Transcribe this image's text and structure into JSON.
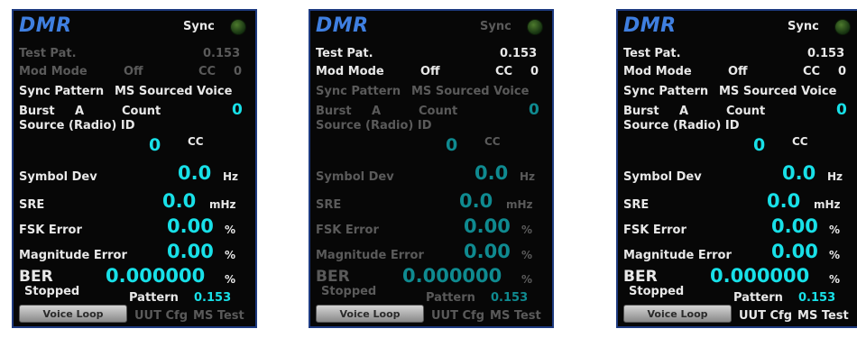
{
  "title": "DMR",
  "sync_label": "Sync",
  "test_pat_label": "Test Pat.",
  "test_pat_value": "0.153",
  "mod_mode_label": "Mod Mode",
  "mod_mode_value": "Off",
  "cc_label": "CC",
  "cc_value": "0",
  "sync_pattern_label": "Sync Pattern",
  "sync_pattern_value": "MS Sourced Voice",
  "burst_label": "Burst",
  "burst_value": "A",
  "count_label": "Count",
  "count_value": "0",
  "source_id_label": "Source (Radio) ID",
  "source_id_value": "0",
  "source_cc_label": "CC",
  "symbol_dev_label": "Symbol Dev",
  "symbol_dev_value": "0.0",
  "symbol_dev_unit": "Hz",
  "sre_label": "SRE",
  "sre_value": "0.0",
  "sre_unit": "mHz",
  "fsk_label": "FSK Error",
  "fsk_value": "0.00",
  "fsk_unit": "%",
  "mag_label": "Magnitude Error",
  "mag_value": "0.00",
  "mag_unit": "%",
  "ber_label": "BER",
  "ber_value": "0.000000",
  "ber_unit": "%",
  "stopped_label": "Stopped",
  "pattern_label": "Pattern",
  "pattern_value": "0.153",
  "voice_loop_label": "Voice Loop",
  "uut_cfg_label": "UUT Cfg",
  "ms_test_label": "MS Test",
  "colors": {
    "accent": "#18e0e8",
    "title": "#3f7fe0",
    "border": "#1d3a80",
    "background": "#070707"
  }
}
